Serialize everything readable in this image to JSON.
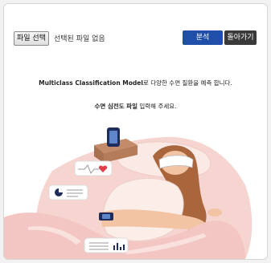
{
  "upload": {
    "file_button_label": "파일 선택",
    "file_status": "선택된 파일 없음"
  },
  "toolbar": {
    "analyze_label": "분석",
    "back_label": "돌아가기"
  },
  "intro": {
    "model_name": "Multiclass Classification Model",
    "model_suffix": "로 다양한 수면 질환을 예측 합니다."
  },
  "instruction": {
    "emphasis": "수면 심전도 파일",
    "suffix": " 입력해 주세요."
  },
  "colors": {
    "primary_button": "#1f4fa8",
    "secondary_button": "#3a3a3a",
    "blanket": "#f4c6c3",
    "heart": "#e0404a",
    "accent_navy": "#1f2d5c"
  }
}
